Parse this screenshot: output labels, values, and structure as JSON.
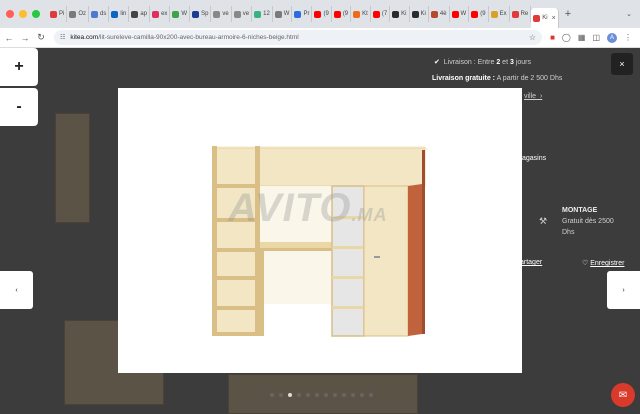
{
  "browser": {
    "tabs": [
      {
        "label": "Pi",
        "color": "#e03b3b"
      },
      {
        "label": "Oz",
        "color": "#7a7a7a"
      },
      {
        "label": "ds",
        "color": "#4a7bd0"
      },
      {
        "label": "lin",
        "color": "#0a66c2"
      },
      {
        "label": "ap",
        "color": "#444444"
      },
      {
        "label": "ex",
        "color": "#e02f5e"
      },
      {
        "label": "W",
        "color": "#3fa34d"
      },
      {
        "label": "Sp",
        "color": "#1d3b8f"
      },
      {
        "label": "ve",
        "color": "#888888"
      },
      {
        "label": "ve",
        "color": "#888888"
      },
      {
        "label": "12",
        "color": "#36b37e"
      },
      {
        "label": "W",
        "color": "#7a7a7a"
      },
      {
        "label": "Pr",
        "color": "#2d6cdf"
      },
      {
        "label": "(9",
        "color": "#ff0000"
      },
      {
        "label": "(9",
        "color": "#ff0000"
      },
      {
        "label": "Kt",
        "color": "#f06a1a"
      },
      {
        "label": "(7",
        "color": "#ff0000"
      },
      {
        "label": "Ki",
        "color": "#2b2b2b"
      },
      {
        "label": "Ki",
        "color": "#2b2b2b"
      },
      {
        "label": "4è",
        "color": "#b5482d"
      },
      {
        "label": "W",
        "color": "#ff0000"
      },
      {
        "label": "(9",
        "color": "#ff0000"
      },
      {
        "label": "Ex",
        "color": "#d7a22a"
      },
      {
        "label": "Re",
        "color": "#e03b3b"
      },
      {
        "label": "Ki",
        "color": "#e03b3b"
      }
    ],
    "new_tab": "+",
    "url_host": "kitea.com",
    "url_path": "/lit-sureleve-camilla-90x200-avec-bureau-armoire-6-niches-beige.html"
  },
  "background": {
    "delivery_prefix": "Livraison : Entre",
    "delivery_from": "2",
    "delivery_and": "et",
    "delivery_to": "3",
    "delivery_suffix": "jours",
    "free_delivery_label": "Livraison gratuite :",
    "free_delivery_value": "A partir de 2 500 Dhs",
    "city_link": "ville",
    "stores_text": "agasins",
    "montage_label": "MONTAGE",
    "montage_value_1": "Gratuit dès 2500",
    "montage_value_2": "Dhs",
    "share_link": "artager",
    "save_link": "Enregistrer"
  },
  "lightbox": {
    "zoom_in": "+",
    "zoom_out": "-",
    "prev": "‹",
    "next": "›",
    "close": "×",
    "watermark_main": "AVITO",
    "watermark_suffix": ".MA",
    "image_count": 12,
    "active_index": 2
  },
  "colors": {
    "bed_wood": "#f2e6c4",
    "panel_edge": "#d9be86",
    "wardrobe_side": "#c0623b",
    "shelf_grey": "#e6e6e6"
  }
}
